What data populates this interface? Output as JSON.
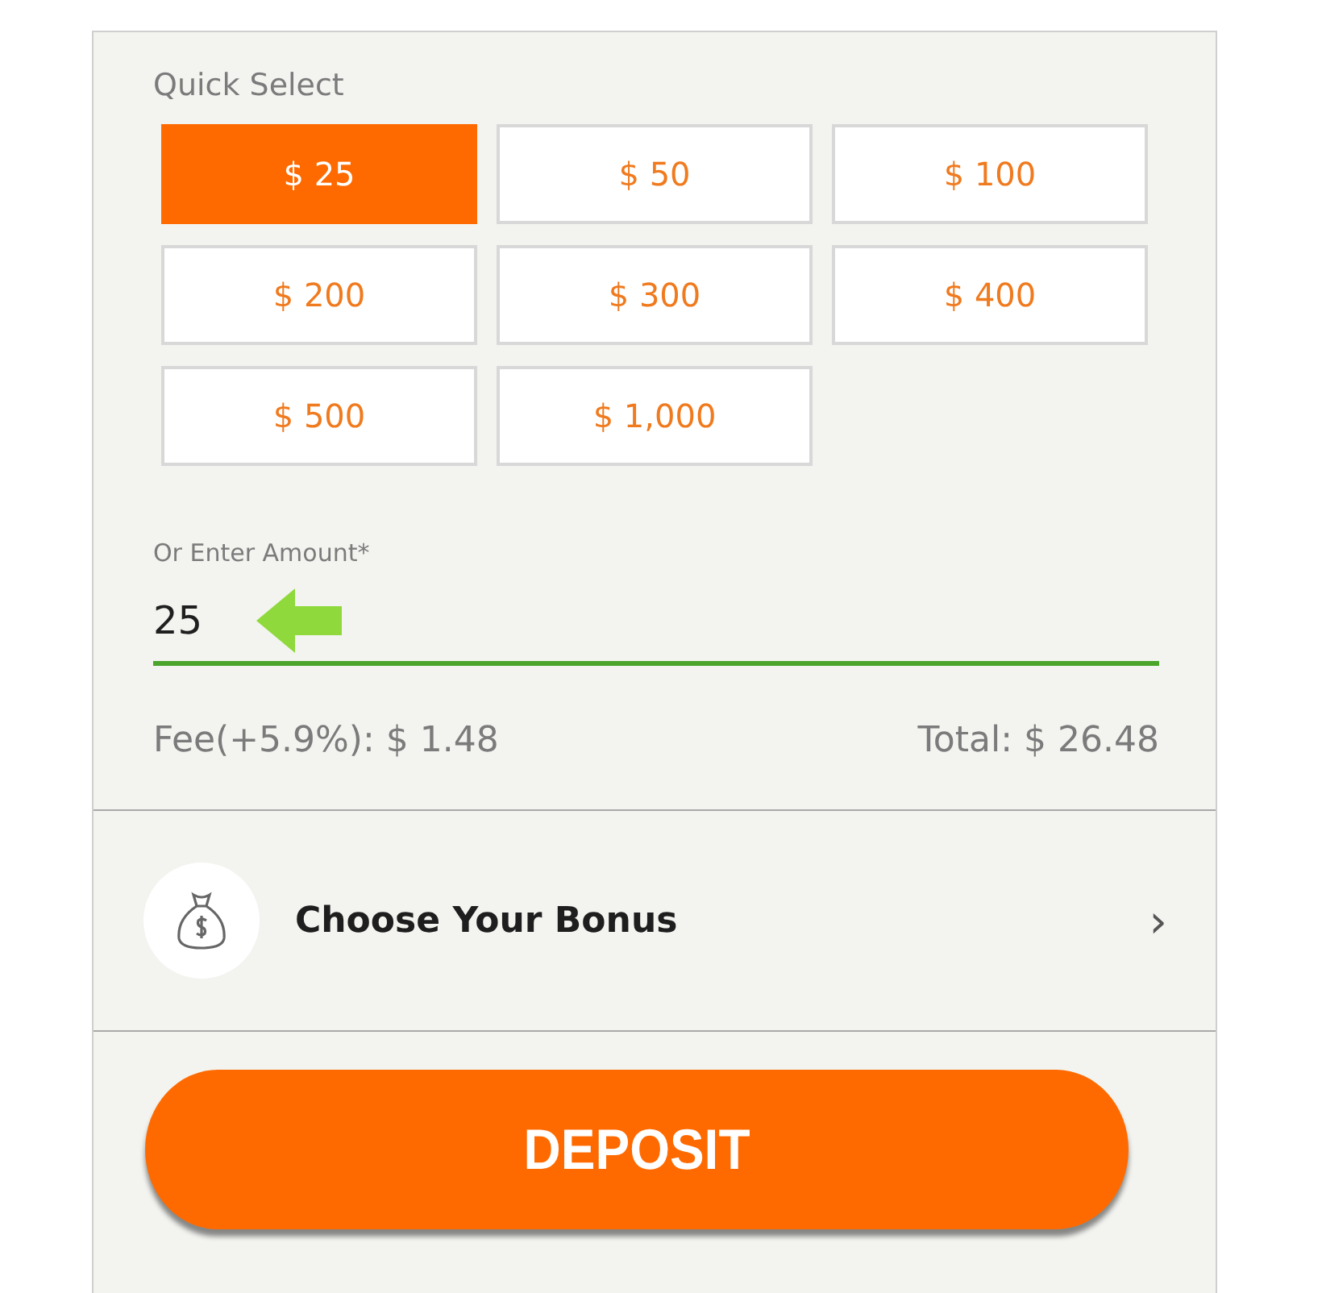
{
  "quick_select": {
    "label": "Quick Select",
    "options": [
      {
        "label": "$ 25",
        "selected": true
      },
      {
        "label": "$ 50",
        "selected": false
      },
      {
        "label": "$ 100",
        "selected": false
      },
      {
        "label": "$ 200",
        "selected": false
      },
      {
        "label": "$ 300",
        "selected": false
      },
      {
        "label": "$ 400",
        "selected": false
      },
      {
        "label": "$ 500",
        "selected": false
      },
      {
        "label": "$ 1,000",
        "selected": false
      }
    ]
  },
  "amount": {
    "label": "Or Enter Amount*",
    "value": "25"
  },
  "fee": "Fee(+5.9%): $ 1.48",
  "total": "Total: $ 26.48",
  "bonus": {
    "label": "Choose Your Bonus",
    "chevron": "›"
  },
  "deposit_button": "DEPOSIT"
}
